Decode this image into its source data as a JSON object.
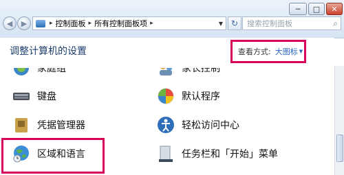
{
  "window": {
    "minimize_glyph": "─",
    "maximize_glyph": "□",
    "close_glyph": "✕"
  },
  "nav": {
    "back_glyph": "◀",
    "forward_glyph": "▶"
  },
  "address": {
    "crumbs": [
      "控制面板",
      "所有控制面板项"
    ],
    "separator": "▸"
  },
  "search": {
    "placeholder": "搜索控制面板"
  },
  "header": {
    "title": "调整计算机的设置",
    "view_by_label": "查看方式:",
    "view_by_value": "大图标"
  },
  "items": [
    {
      "label": "家庭组",
      "icon": "homegroup-icon"
    },
    {
      "label": "家长控制",
      "icon": "parental-controls-icon"
    },
    {
      "label": "键盘",
      "icon": "keyboard-icon"
    },
    {
      "label": "默认程序",
      "icon": "default-programs-icon"
    },
    {
      "label": "凭据管理器",
      "icon": "credential-manager-icon"
    },
    {
      "label": "轻松访问中心",
      "icon": "ease-of-access-icon"
    },
    {
      "label": "区域和语言",
      "icon": "region-language-icon"
    },
    {
      "label": "任务栏和「开始」菜单",
      "icon": "taskbar-start-icon"
    }
  ]
}
